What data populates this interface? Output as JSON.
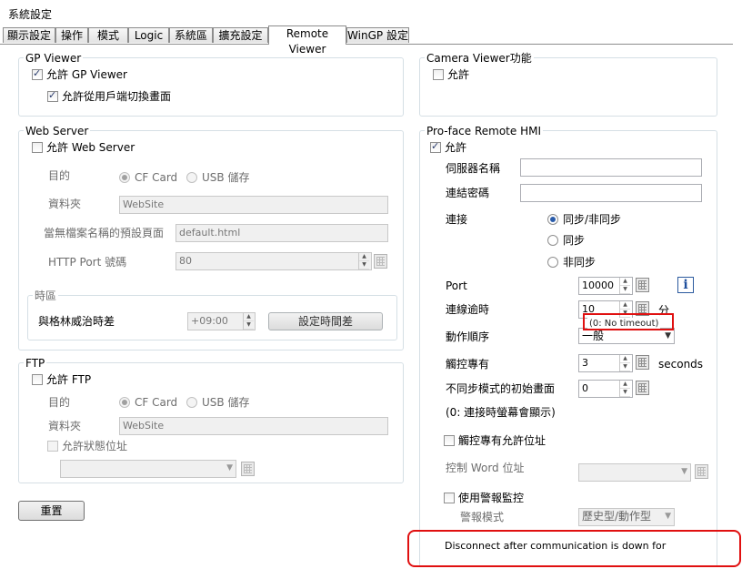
{
  "window": {
    "title": "系統設定"
  },
  "tabs": [
    {
      "label": "顯示設定"
    },
    {
      "label": "操作"
    },
    {
      "label": "模式"
    },
    {
      "label": "Logic"
    },
    {
      "label": "系統區"
    },
    {
      "label": "擴充設定"
    },
    {
      "label": "Remote Viewer"
    },
    {
      "label": "WinGP 設定"
    }
  ],
  "gp_viewer": {
    "legend": "GP Viewer",
    "allow_label": "允許 GP Viewer",
    "allow_switch_label": "允許從用戶端切換畫面"
  },
  "camera_viewer": {
    "legend": "Camera Viewer功能",
    "allow_label": "允許"
  },
  "web_server": {
    "legend": "Web Server",
    "allow_label": "允許 Web Server",
    "destination_label": "目的",
    "cf_card": "CF Card",
    "usb": "USB 儲存",
    "folder_label": "資料夾",
    "folder_value": "WebSite",
    "default_page_label": "當無檔案名稱的預設頁面",
    "default_page_value": "default.html",
    "http_port_label": "HTTP Port 號碼",
    "http_port_value": "80",
    "timezone_legend": "時區",
    "gmt_offset_label": "與格林威治時差",
    "gmt_offset_value": "+09:00",
    "set_time_diff_button": "設定時間差"
  },
  "ftp": {
    "legend": "FTP",
    "allow_label": "允許 FTP",
    "destination_label": "目的",
    "cf_card": "CF Card",
    "usb": "USB 儲存",
    "folder_label": "資料夾",
    "folder_value": "WebSite",
    "status_address_label": "允許狀態位址"
  },
  "reset_button": "重置",
  "remote_hmi": {
    "legend": "Pro-face Remote HMI",
    "allow_label": "允許",
    "server_name_label": "伺服器名稱",
    "password_label": "連結密碼",
    "connection_label": "連接",
    "sync_async": "同步/非同步",
    "sync": "同步",
    "async": "非同步",
    "port_label": "Port",
    "port_value": "10000",
    "timeout_label": "連線逾時",
    "timeout_value": "10",
    "timeout_unit": "分",
    "timeout_tooltip": "(0: No timeout)",
    "action_order_label": "動作順序",
    "action_order_value": "一般",
    "exclusive_label": "觸控專有",
    "exclusive_value": "3",
    "exclusive_unit": "seconds",
    "async_initial_screen_label": "不同步模式的初始畫面",
    "async_initial_screen_value": "0",
    "async_note": "(0: 連接時螢幕會顯示)",
    "exclusive_address_label": "觸控專有允許位址",
    "control_word_label": "控制 Word 位址",
    "alarm_monitor_label": "使用警報監控",
    "alarm_mode_label": "警報模式",
    "alarm_mode_value": "歷史型/動作型",
    "disconnect_label": "Disconnect after communication is down for"
  },
  "colors": {
    "highlight": "#e01010",
    "accent": "#2a5caa"
  }
}
